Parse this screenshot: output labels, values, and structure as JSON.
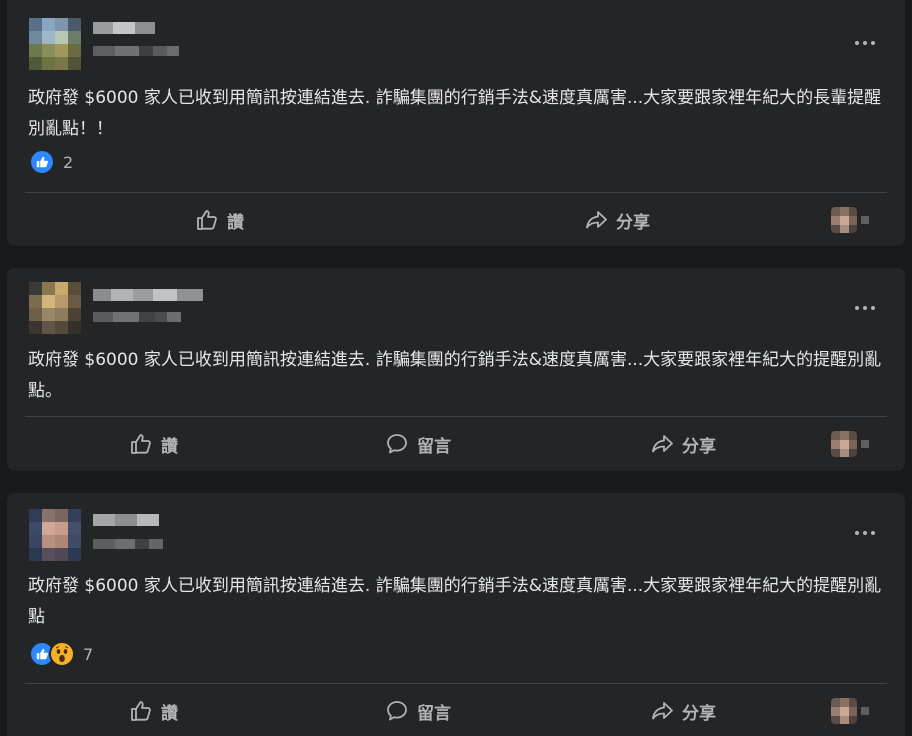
{
  "posts": [
    {
      "text": "政府發 $6000 家人已收到用簡訊按連結進去. 詐騙集團的行銷手法&速度真厲害...大家要跟家裡年紀大的長輩提醒別亂點！！",
      "reactions": [
        "like"
      ],
      "reaction_count": "2",
      "actions": {
        "like": "讚",
        "share": "分享"
      }
    },
    {
      "text": "政府發 $6000 家人已收到用簡訊按連結進去. 詐騙集團的行銷手法&速度真厲害...大家要跟家裡年紀大的提醒別亂點。",
      "actions": {
        "like": "讚",
        "comment": "留言",
        "share": "分享"
      }
    },
    {
      "text": "政府發 $6000 家人已收到用簡訊按連結進去. 詐騙集團的行銷手法&速度真厲害...大家要跟家裡年紀大的提醒別亂點",
      "reactions": [
        "like",
        "wow"
      ],
      "reaction_count": "7",
      "actions": {
        "like": "讚",
        "comment": "留言",
        "share": "分享"
      }
    }
  ],
  "icons": {
    "more": "more-options-icon",
    "like": "thumbs-up-icon",
    "comment": "comment-bubble-icon",
    "share": "share-arrow-icon",
    "reaction_like": "like-reaction-icon",
    "reaction_wow": "wow-reaction-icon"
  },
  "colors": {
    "background": "#18191a",
    "card": "#242526",
    "text_primary": "#e4e6eb",
    "text_secondary": "#b0b3b8",
    "like_blue": "#2d88ff",
    "wow_yellow": "#f7b125",
    "divider": "#3e4042"
  }
}
